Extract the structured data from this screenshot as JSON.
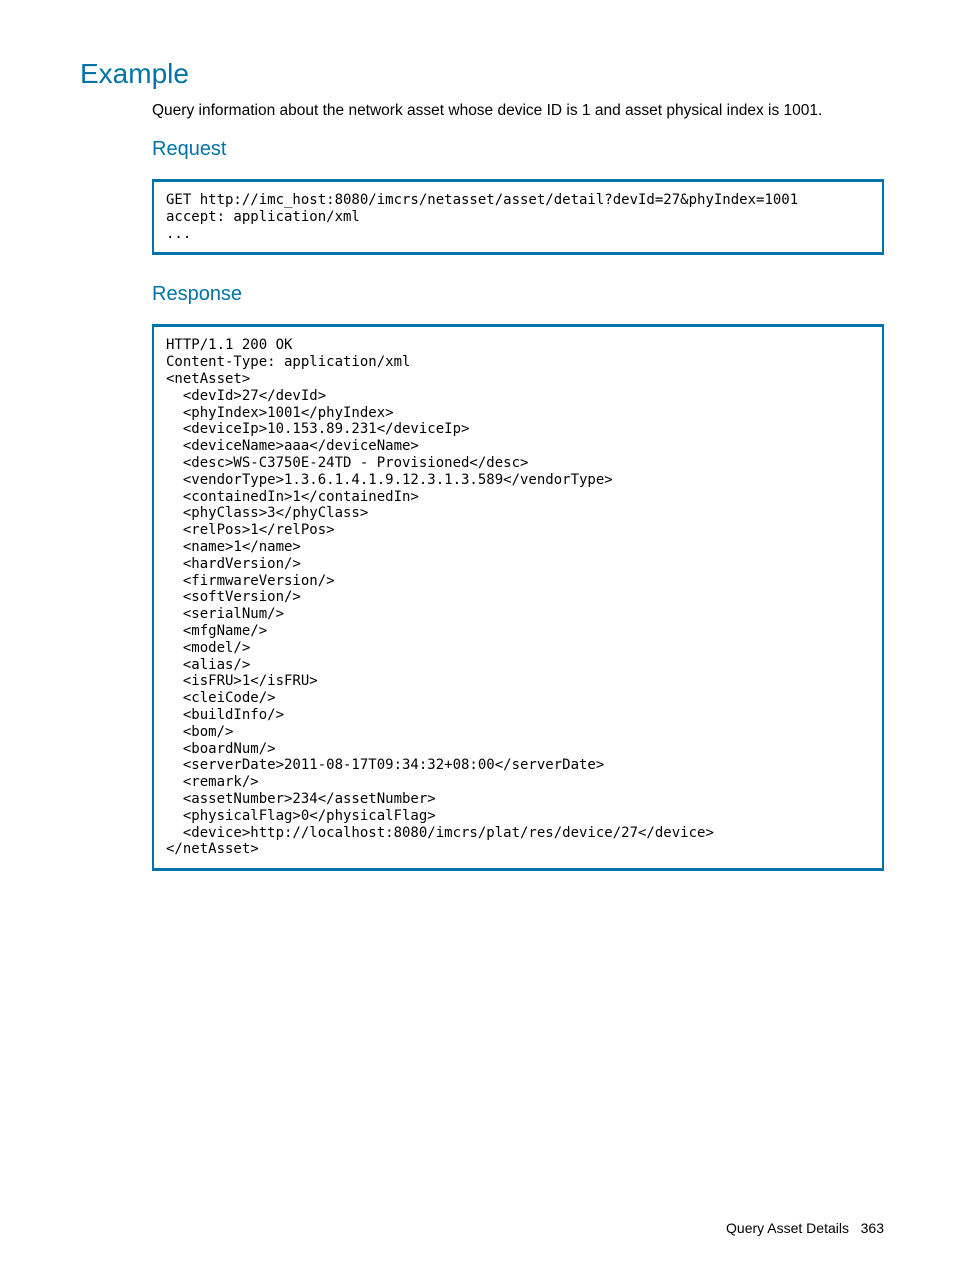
{
  "example": {
    "heading": "Example",
    "description": "Query information about the network asset whose device ID is 1 and asset physical index is 1001.",
    "request_heading": "Request",
    "request_code": "GET http://imc_host:8080/imcrs/netasset/asset/detail?devId=27&phyIndex=1001\naccept: application/xml\n...",
    "response_heading": "Response",
    "response_code": "HTTP/1.1 200 OK\nContent-Type: application/xml\n<netAsset>\n  <devId>27</devId>\n  <phyIndex>1001</phyIndex>\n  <deviceIp>10.153.89.231</deviceIp>\n  <deviceName>aaa</deviceName>\n  <desc>WS-C3750E-24TD - Provisioned</desc>\n  <vendorType>1.3.6.1.4.1.9.12.3.1.3.589</vendorType>\n  <containedIn>1</containedIn>\n  <phyClass>3</phyClass>\n  <relPos>1</relPos>\n  <name>1</name>\n  <hardVersion/>\n  <firmwareVersion/>\n  <softVersion/>\n  <serialNum/>\n  <mfgName/>\n  <model/>\n  <alias/>\n  <isFRU>1</isFRU>\n  <cleiCode/>\n  <buildInfo/>\n  <bom/>\n  <boardNum/>\n  <serverDate>2011-08-17T09:34:32+08:00</serverDate>\n  <remark/>\n  <assetNumber>234</assetNumber>\n  <physicalFlag>0</physicalFlag>\n  <device>http://localhost:8080/imcrs/plat/res/device/27</device>\n</netAsset>"
  },
  "footer": {
    "section_title": "Query Asset Details",
    "page_number": "363"
  }
}
